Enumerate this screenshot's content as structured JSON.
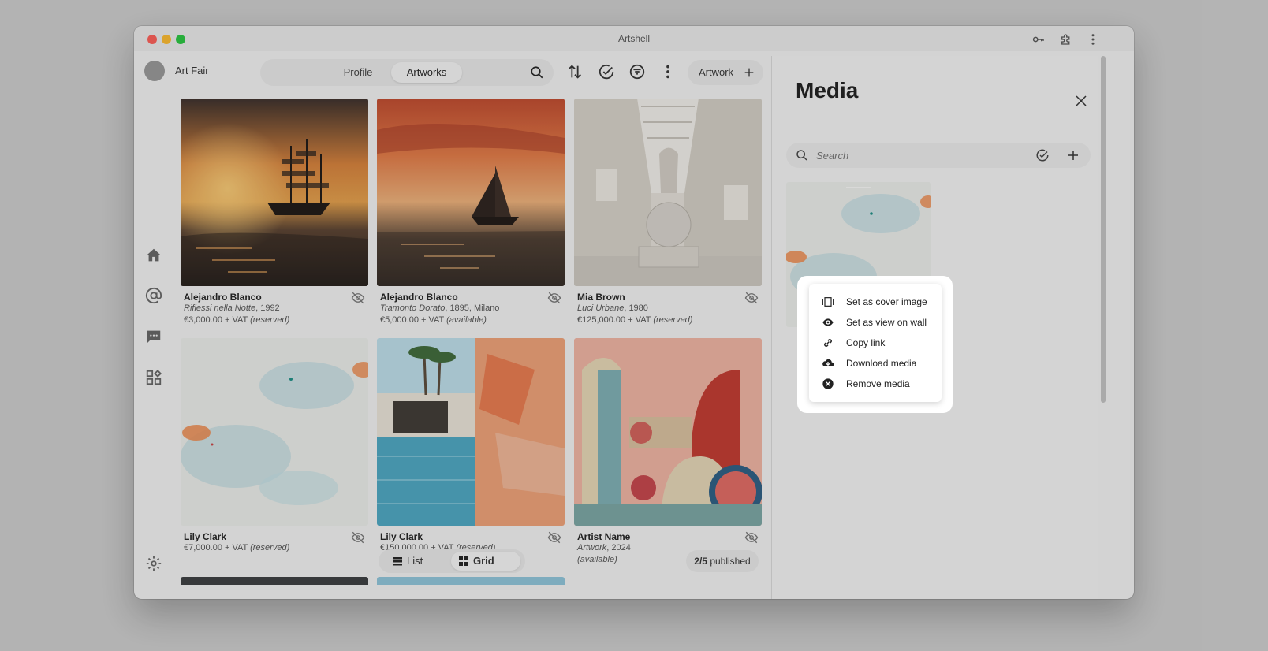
{
  "window": {
    "title": "Artshell"
  },
  "sidebar": {
    "org_name": "Art Fair"
  },
  "tabs": {
    "profile": "Profile",
    "artworks": "Artworks"
  },
  "toolbar": {
    "artwork_button": "Artwork"
  },
  "cards": [
    {
      "artist": "Alejandro Blanco",
      "title": "Riflessi nella Notte",
      "meta": ", 1992",
      "price": "€3,000.00 + VAT",
      "status": "(reserved)"
    },
    {
      "artist": "Alejandro Blanco",
      "title": "Tramonto Dorato",
      "meta": ", 1895, Milano",
      "price": "€5,000.00 + VAT",
      "status": "(available)"
    },
    {
      "artist": "Mia Brown",
      "title": "Luci Urbane",
      "meta": ", 1980",
      "price": "€125,000.00 + VAT",
      "status": "(reserved)"
    },
    {
      "artist": "Lily Clark",
      "price": "€7,000.00 + VAT",
      "status": "(reserved)"
    },
    {
      "artist": "Lily Clark",
      "price": "€150,000.00 + VAT",
      "status": "(reserved)"
    },
    {
      "artist": "Artist Name",
      "title": "Artwork",
      "meta": ", 2024",
      "status": "(available)"
    }
  ],
  "view_toggle": {
    "list": "List",
    "grid": "Grid"
  },
  "published": {
    "count": "2/5",
    "label": "published"
  },
  "panel": {
    "title": "Media",
    "search_placeholder": "Search"
  },
  "context_menu": [
    {
      "icon": "cover-image-icon",
      "label": "Set as cover image"
    },
    {
      "icon": "eye-icon",
      "label": "Set as view on wall"
    },
    {
      "icon": "link-icon",
      "label": "Copy link"
    },
    {
      "icon": "cloud-download-icon",
      "label": "Download media"
    },
    {
      "icon": "close-circle-icon",
      "label": "Remove media"
    }
  ]
}
